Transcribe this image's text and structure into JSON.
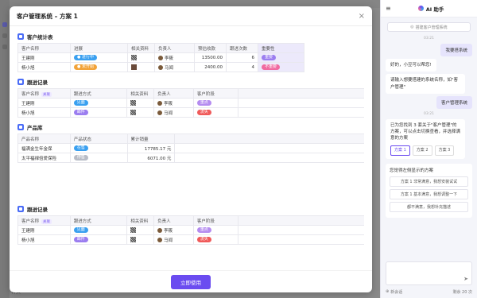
{
  "background": {
    "bottom_text": "首页"
  },
  "modal": {
    "title": "客户管理系统 – 方案 1",
    "close": "×",
    "use_button": "立即使用"
  },
  "customer_stats": {
    "title": "客户统计表",
    "columns": [
      "客户名称",
      "进展",
      "相关资料",
      "负责人",
      "预估收款",
      "跟进次数",
      "重要性"
    ],
    "rows": [
      {
        "name": "王建刚",
        "progress": "进行中",
        "owner": "李筱",
        "amount": "13500.00",
        "count": "6",
        "importance": "重要"
      },
      {
        "name": "杨小旭",
        "progress": "未开始",
        "owner": "马闻",
        "amount": "2400.00",
        "count": "4",
        "importance": "不重要"
      }
    ]
  },
  "follow_up_1": {
    "title": "跟进记录",
    "columns": [
      "客户名称",
      "跟进方式",
      "相关资料",
      "负责人",
      "客户阶段"
    ],
    "assoc": "关联",
    "rows": [
      {
        "name": "王建刚",
        "method": "见面",
        "owner": "李筱",
        "stage": "重点"
      },
      {
        "name": "杨小旭",
        "method": "邮件",
        "owner": "马闻",
        "stage": "流失"
      }
    ]
  },
  "products": {
    "title": "产品库",
    "columns": [
      "产品名称",
      "产品状态",
      "累计销量"
    ],
    "rows": [
      {
        "name": "福满金生年金保",
        "status": "在售",
        "sales": "17785.17 元"
      },
      {
        "name": "太平福禄倍爱保险",
        "status": "停售",
        "sales": "6071.00 元"
      }
    ]
  },
  "follow_up_2": {
    "title": "跟进记录",
    "columns": [
      "客户名称",
      "跟进方式",
      "相关资料",
      "负责人",
      "客户阶段"
    ],
    "assoc": "关联",
    "rows": [
      {
        "name": "王建刚",
        "method": "见面",
        "owner": "李筱",
        "stage": "重点"
      },
      {
        "name": "杨小旭",
        "method": "邮件",
        "owner": "马闻",
        "stage": "流失"
      }
    ]
  },
  "assistant": {
    "title": "AI 助手",
    "new_chat_hint": "搭建客户管理系统",
    "timestamp": "03:21",
    "msg_user_1": "我要搭系统",
    "msg_bot_1": "好的，小豆可以帮您!",
    "msg_bot_2": "请输入想要搭建的系统名称，如\"客户管理\"",
    "msg_user_2": "客户管理系统",
    "msg_bot_3": "已为您找到 3 套关于\"客户管理\"的方案，可以点击切换查看，并选择满意的方案",
    "plans": [
      "方案 1",
      "方案 2",
      "方案 3"
    ],
    "feedback_title": "您觉得左侧显示的方案",
    "feedback_options": [
      "方案 1 非常满意，我想安装试试",
      "方案 1 基本满意，我想调整一下",
      "都不满意，我想补充描述"
    ],
    "footer_new": "新会话",
    "footer_remain": "剩余 20 次"
  }
}
